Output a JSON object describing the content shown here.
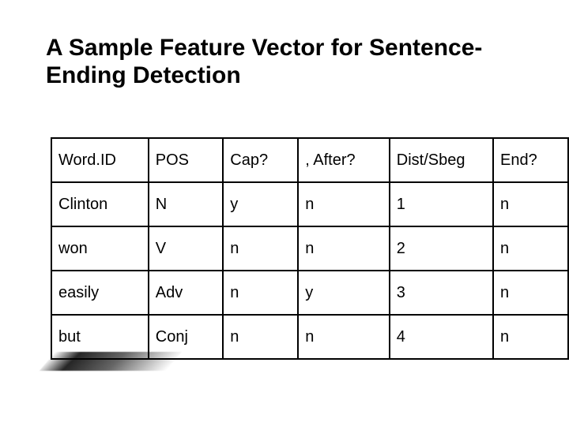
{
  "title_line1": "A Sample Feature Vector for Sentence-",
  "title_line2": "Ending Detection",
  "table": {
    "headers": [
      "Word.ID",
      "POS",
      "Cap?",
      ", After?",
      "Dist/Sbeg",
      "End?"
    ],
    "rows": [
      [
        "Clinton",
        "N",
        "y",
        "n",
        "1",
        "n"
      ],
      [
        "won",
        "V",
        "n",
        "n",
        "2",
        "n"
      ],
      [
        "easily",
        "Adv",
        "n",
        "y",
        "3",
        "n"
      ],
      [
        "but",
        "Conj",
        "n",
        "n",
        "4",
        "n"
      ]
    ]
  },
  "chart_data": {
    "type": "table",
    "title": "A Sample Feature Vector for Sentence-Ending Detection",
    "columns": [
      "Word.ID",
      "POS",
      "Cap?",
      ", After?",
      "Dist/Sbeg",
      "End?"
    ],
    "rows": [
      {
        "Word.ID": "Clinton",
        "POS": "N",
        "Cap?": "y",
        ", After?": "n",
        "Dist/Sbeg": 1,
        "End?": "n"
      },
      {
        "Word.ID": "won",
        "POS": "V",
        "Cap?": "n",
        ", After?": "n",
        "Dist/Sbeg": 2,
        "End?": "n"
      },
      {
        "Word.ID": "easily",
        "POS": "Adv",
        "Cap?": "n",
        ", After?": "y",
        "Dist/Sbeg": 3,
        "End?": "n"
      },
      {
        "Word.ID": "but",
        "POS": "Conj",
        "Cap?": "n",
        ", After?": "n",
        "Dist/Sbeg": 4,
        "End?": "n"
      }
    ]
  }
}
